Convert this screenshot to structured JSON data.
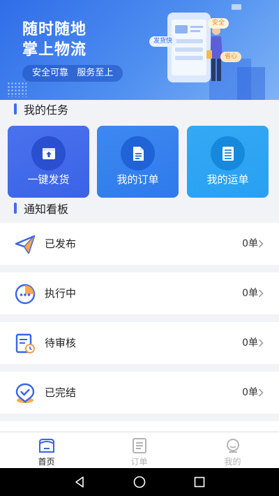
{
  "banner": {
    "title_line1": "随时随地",
    "title_line2": "掌上物流",
    "tagline": "安全可靠   服务至上",
    "bubble_fast": "发货快",
    "bubble_safe": "安全",
    "bubble_easy": "省心"
  },
  "tasks": {
    "heading": "我的任务",
    "cards": [
      {
        "label": "一键发货",
        "icon": "box-icon"
      },
      {
        "label": "我的订单",
        "icon": "document-icon"
      },
      {
        "label": "我的运单",
        "icon": "list-icon"
      }
    ]
  },
  "notices": {
    "heading": "通知看板",
    "rows": [
      {
        "label": "已发布",
        "count": "0单",
        "icon": "paper-plane-icon"
      },
      {
        "label": "执行中",
        "count": "0单",
        "icon": "in-progress-icon"
      },
      {
        "label": "待审核",
        "count": "0单",
        "icon": "review-clock-icon"
      },
      {
        "label": "已完结",
        "count": "0单",
        "icon": "check-badge-icon"
      }
    ]
  },
  "tabbar": {
    "active": "home",
    "tabs": [
      {
        "label": "首页",
        "icon": "home-icon"
      },
      {
        "label": "订单",
        "icon": "order-icon"
      },
      {
        "label": "我的",
        "icon": "profile-icon"
      }
    ]
  },
  "colors": {
    "accent": "#3b6ef0",
    "tab_active": "#3a63e6",
    "tab_inactive": "#b3b3b3"
  }
}
